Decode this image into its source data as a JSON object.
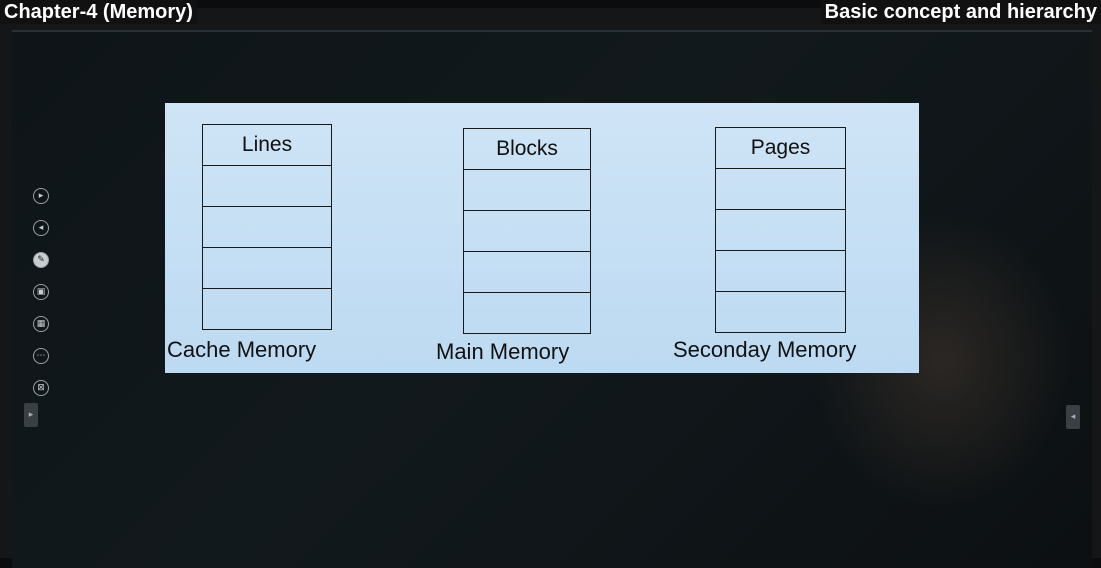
{
  "captions": {
    "left": "Chapter-4 (Memory)",
    "right": "Basic concept and hierarchy"
  },
  "slide": {
    "stacks": [
      {
        "header": "Lines",
        "label": "Cache Memory",
        "rows": 4
      },
      {
        "header": "Blocks",
        "label": "Main Memory",
        "rows": 4
      },
      {
        "header": "Pages",
        "label": "Seconday Memory",
        "rows": 4
      }
    ]
  },
  "toolbar": {
    "icons": [
      "next-icon",
      "previous-icon",
      "pen-icon",
      "pages-icon",
      "gallery-icon",
      "more-icon",
      "exit-icon"
    ],
    "glyphs": [
      "▸",
      "◂",
      "✎",
      "▣",
      "▦",
      "⋯",
      "⊠"
    ]
  },
  "colors": {
    "slide_bg": "#bcdaf2",
    "caption_bg": "#111111",
    "caption_text": "#ffffff"
  }
}
